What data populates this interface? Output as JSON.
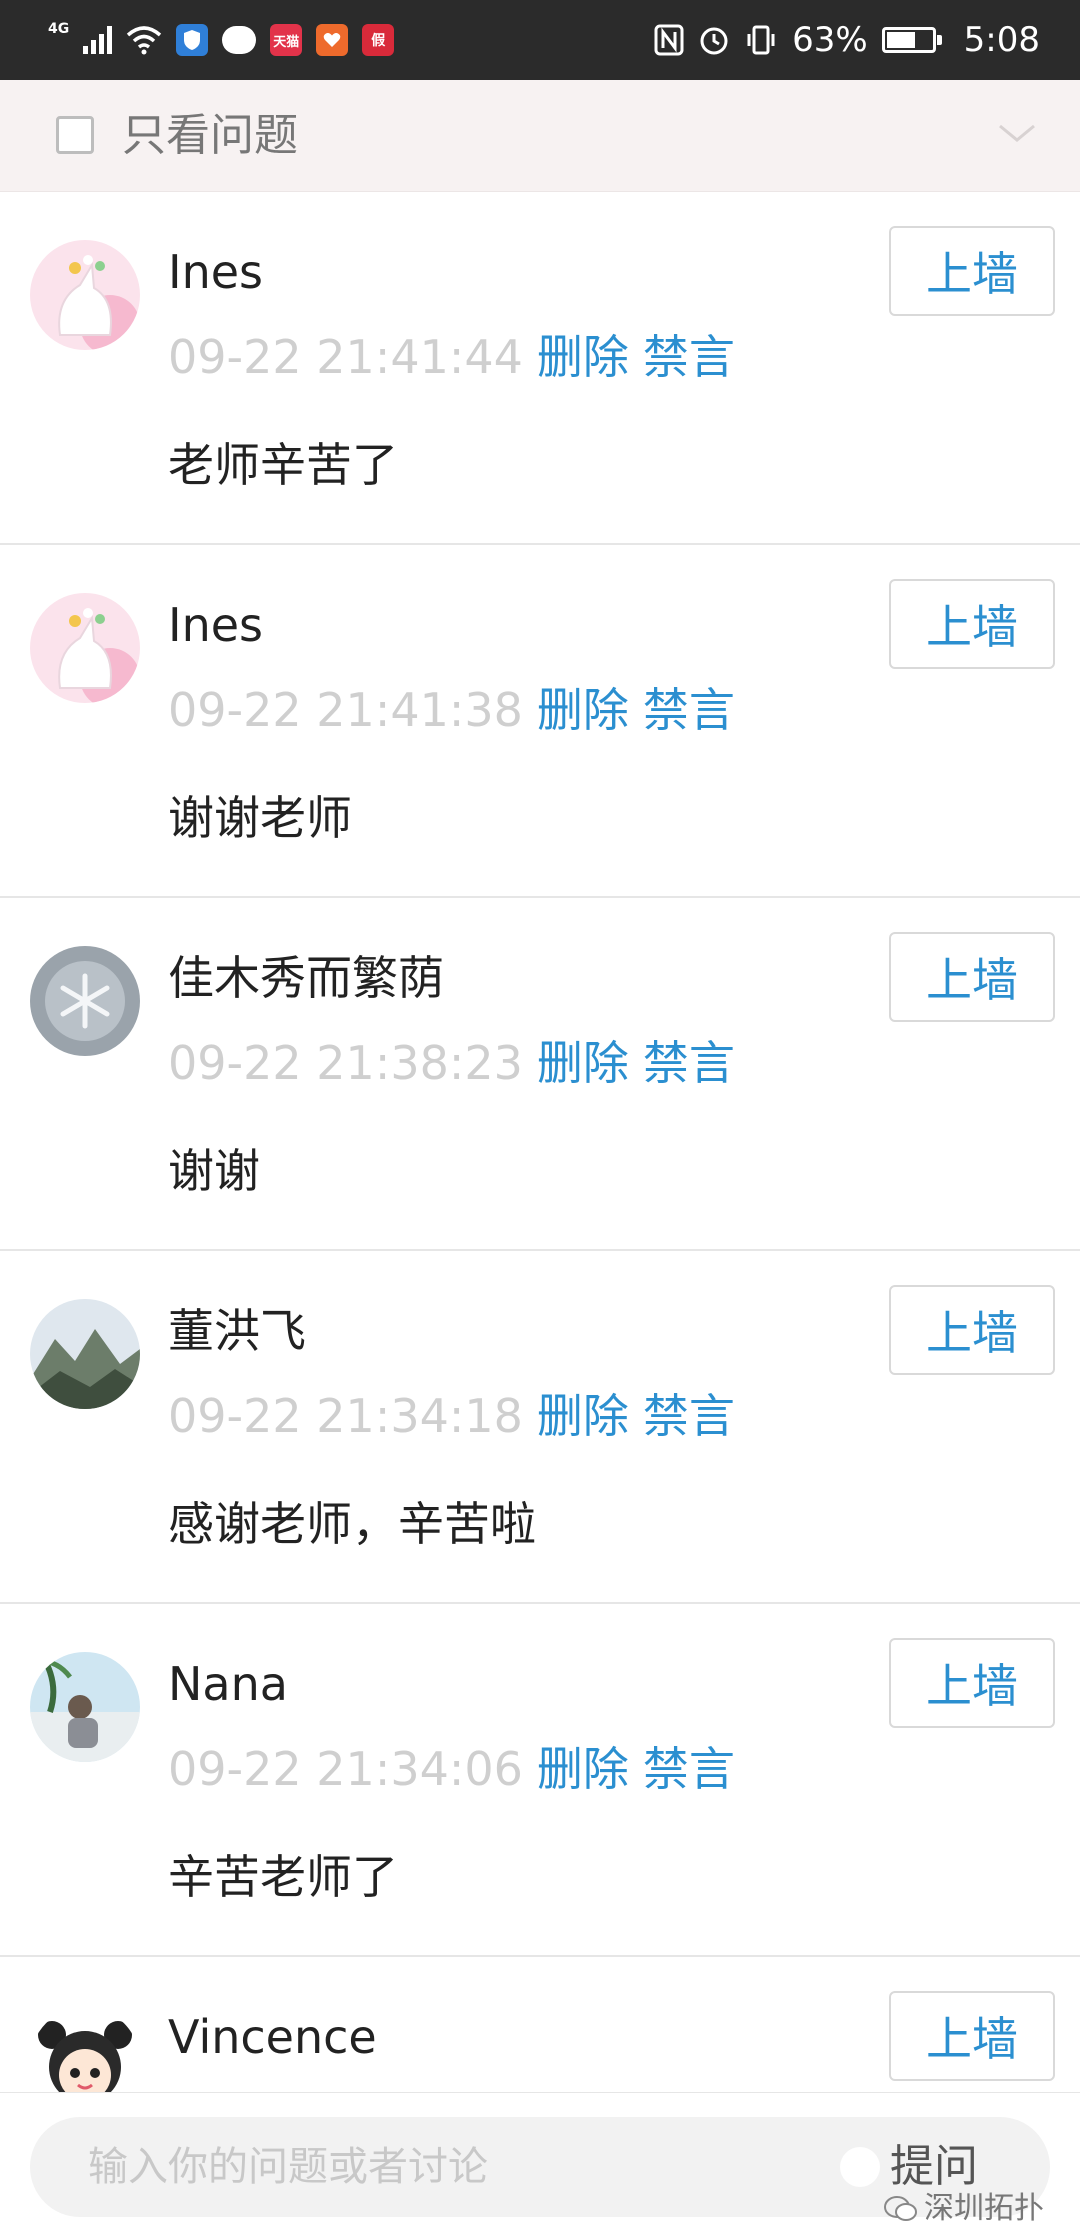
{
  "status_bar": {
    "network": "4G",
    "app_icons": [
      {
        "name": "shield-app-icon",
        "label": "",
        "color": "#2f7fd8"
      },
      {
        "name": "chat-bubble-icon",
        "label": "",
        "color": "#ffffff"
      },
      {
        "name": "tianmao-app-icon",
        "label": "天猫",
        "color": "#e2334a"
      },
      {
        "name": "heart-app-icon",
        "label": "",
        "color": "#ee6a2c"
      },
      {
        "name": "red-app-icon",
        "label": "假",
        "color": "#d92a3a"
      }
    ],
    "battery_percent": "63%",
    "battery_level": 0.63,
    "time": "5:08"
  },
  "filter_bar": {
    "checkbox_label": "只看问题",
    "checked": false
  },
  "comments": [
    {
      "username": "Ines",
      "timestamp": "09-22 21:41:44",
      "delete_label": "删除",
      "mute_label": "禁言",
      "message": "老师辛苦了",
      "wall_button": "上墙",
      "avatar": "unicorn-avatar"
    },
    {
      "username": "Ines",
      "timestamp": "09-22 21:41:38",
      "delete_label": "删除",
      "mute_label": "禁言",
      "message": "谢谢老师",
      "wall_button": "上墙",
      "avatar": "unicorn-avatar"
    },
    {
      "username": "佳木秀而繁荫",
      "timestamp": "09-22 21:38:23",
      "delete_label": "删除",
      "mute_label": "禁言",
      "message": "谢谢",
      "wall_button": "上墙",
      "avatar": "snowflake-avatar"
    },
    {
      "username": "董洪飞",
      "timestamp": "09-22 21:34:18",
      "delete_label": "删除",
      "mute_label": "禁言",
      "message": "感谢老师，辛苦啦",
      "wall_button": "上墙",
      "avatar": "mountain-avatar"
    },
    {
      "username": "Nana",
      "timestamp": "09-22 21:34:06",
      "delete_label": "删除",
      "mute_label": "禁言",
      "message": "辛苦老师了",
      "wall_button": "上墙",
      "avatar": "beach-avatar"
    },
    {
      "username": "Vincence",
      "timestamp": "",
      "delete_label": "",
      "mute_label": "",
      "message": "",
      "wall_button": "上墙",
      "avatar": "anime-avatar"
    }
  ],
  "input_bar": {
    "placeholder": "输入你的问题或者讨论",
    "ask_label": "提问"
  },
  "watermark": "深圳拓扑",
  "colors": {
    "accent": "#2b8fd0",
    "timestamp": "#cfcfcf",
    "status_bar_bg": "#2b2b2b",
    "filter_bar_bg": "#f7f2f2"
  }
}
